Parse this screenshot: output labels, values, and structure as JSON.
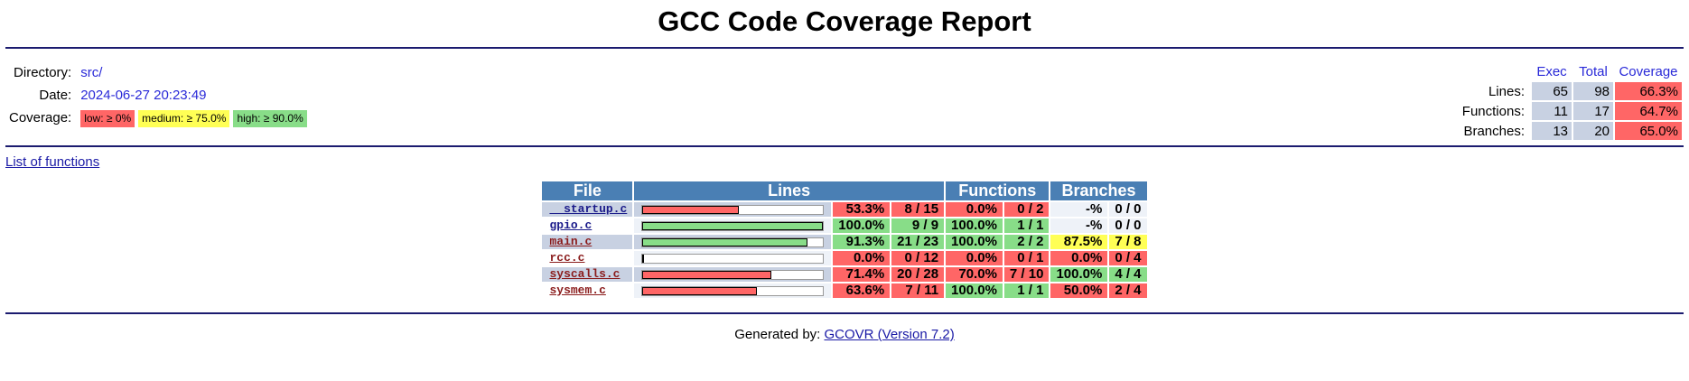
{
  "title": "GCC Code Coverage Report",
  "info": {
    "directory_label": "Directory:",
    "directory": "src/",
    "date_label": "Date:",
    "date": "2024-06-27 20:23:49",
    "coverage_label": "Coverage:",
    "legend": [
      {
        "label": "low: ≥ 0%",
        "color": "#ff6666"
      },
      {
        "label": "medium: ≥ 75.0%",
        "color": "#ffff55"
      },
      {
        "label": "high: ≥ 90.0%",
        "color": "#88dd88"
      }
    ]
  },
  "summary": {
    "headers": [
      "Exec",
      "Total",
      "Coverage"
    ],
    "rows": [
      {
        "label": "Lines:",
        "exec": "65",
        "total": "98",
        "coverage": "66.3%"
      },
      {
        "label": "Functions:",
        "exec": "11",
        "total": "17",
        "coverage": "64.7%"
      },
      {
        "label": "Branches:",
        "exec": "13",
        "total": "20",
        "coverage": "65.0%"
      }
    ]
  },
  "functions_link": "List of functions",
  "table": {
    "headers": [
      "File",
      "Lines",
      "Functions",
      "Branches"
    ],
    "rows": [
      {
        "file": "__startup.c",
        "file_color": "blue",
        "line_fraction": 0.533,
        "lines_pct": "53.3%",
        "lines_ratio": "8 / 15",
        "lines_level": "red",
        "func_pct": "0.0%",
        "func_ratio": "0 / 2",
        "func_level": "red",
        "br_pct": "-%",
        "br_ratio": "0 / 0",
        "br_level": "neu"
      },
      {
        "file": "gpio.c",
        "file_color": "blue",
        "line_fraction": 1.0,
        "lines_pct": "100.0%",
        "lines_ratio": "9 / 9",
        "lines_level": "grn",
        "func_pct": "100.0%",
        "func_ratio": "1 / 1",
        "func_level": "grn",
        "br_pct": "-%",
        "br_ratio": "0 / 0",
        "br_level": "neu"
      },
      {
        "file": "main.c",
        "file_color": "red",
        "line_fraction": 0.913,
        "lines_pct": "91.3%",
        "lines_ratio": "21 / 23",
        "lines_level": "grn",
        "func_pct": "100.0%",
        "func_ratio": "2 / 2",
        "func_level": "grn",
        "br_pct": "87.5%",
        "br_ratio": "7 / 8",
        "br_level": "yel"
      },
      {
        "file": "rcc.c",
        "file_color": "red",
        "line_fraction": 0.0,
        "lines_pct": "0.0%",
        "lines_ratio": "0 / 12",
        "lines_level": "red",
        "func_pct": "0.0%",
        "func_ratio": "0 / 1",
        "func_level": "red",
        "br_pct": "0.0%",
        "br_ratio": "0 / 4",
        "br_level": "red"
      },
      {
        "file": "syscalls.c",
        "file_color": "red",
        "line_fraction": 0.714,
        "lines_pct": "71.4%",
        "lines_ratio": "20 / 28",
        "lines_level": "red",
        "func_pct": "70.0%",
        "func_ratio": "7 / 10",
        "func_level": "red",
        "br_pct": "100.0%",
        "br_ratio": "4 / 4",
        "br_level": "grn"
      },
      {
        "file": "sysmem.c",
        "file_color": "red",
        "line_fraction": 0.636,
        "lines_pct": "63.6%",
        "lines_ratio": "7 / 11",
        "lines_level": "red",
        "func_pct": "100.0%",
        "func_ratio": "1 / 1",
        "func_level": "grn",
        "br_pct": "50.0%",
        "br_ratio": "2 / 4",
        "br_level": "red"
      }
    ]
  },
  "footer": {
    "prefix": "Generated by: ",
    "link": "GCOVR (Version 7.2)"
  }
}
